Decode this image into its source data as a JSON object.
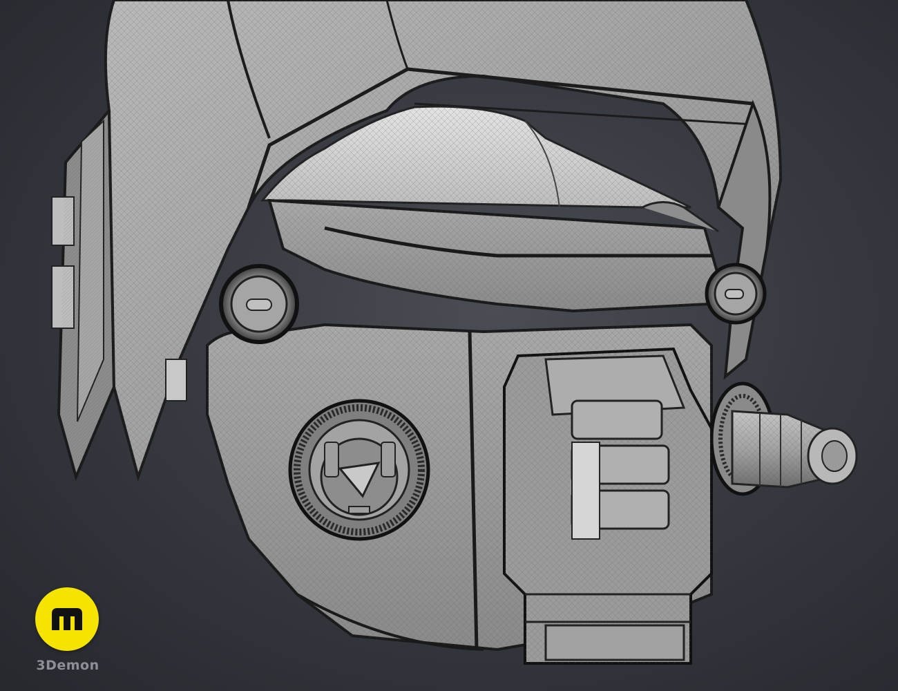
{
  "scene": {
    "subject": "helmet-wireframe-render",
    "background_color": "#34373d",
    "mesh_color": "#9a9a9a",
    "wire_color": "#1a1a1a"
  },
  "branding": {
    "logo_icon": "3demon-logo-icon",
    "logo_color": "#f5e300",
    "name": "3Demon"
  }
}
